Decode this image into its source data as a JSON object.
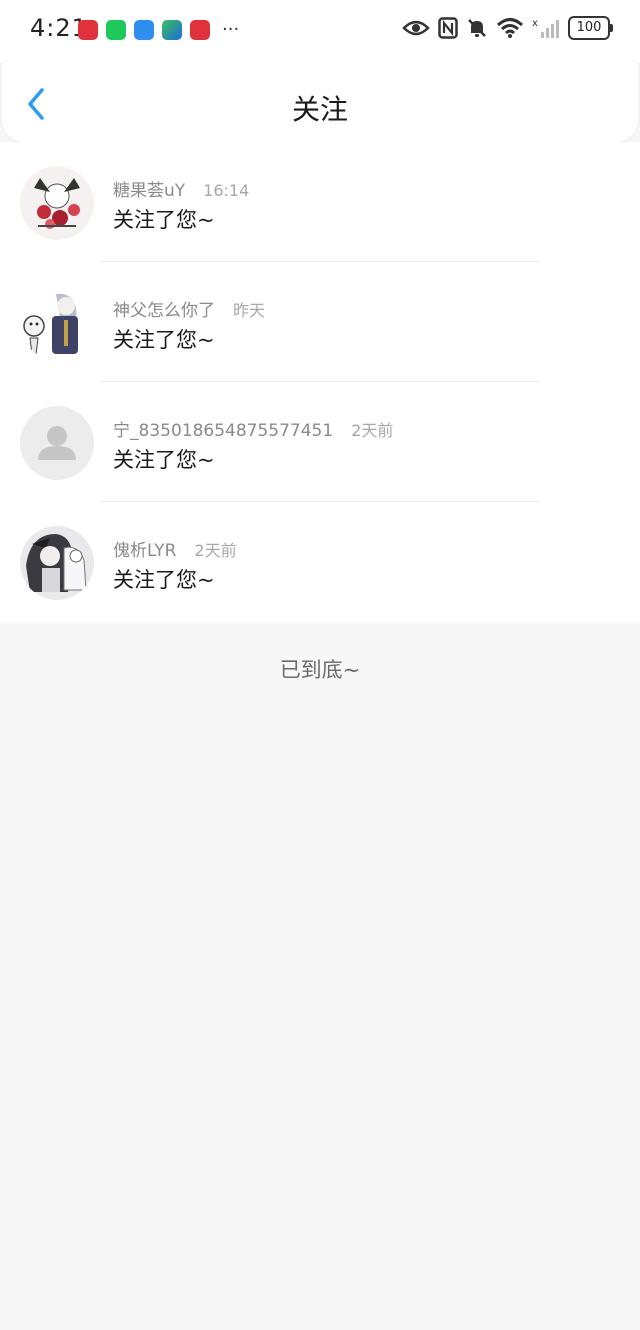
{
  "status_bar": {
    "time": "4:21",
    "battery": "100",
    "more": "···",
    "app_icons": [
      {
        "name": "huawei-icon",
        "color": "#e0323c"
      },
      {
        "name": "wechat-icon",
        "color": "#1ec85a"
      },
      {
        "name": "bookmark-app-icon",
        "color": "#2f8ef0"
      },
      {
        "name": "video-app-icon",
        "color": "#3bc05a"
      },
      {
        "name": "huawei-icon",
        "color": "#e0323c"
      }
    ]
  },
  "header": {
    "title": "关注"
  },
  "list": {
    "items": [
      {
        "name": "糖果荟uY",
        "time": "16:14",
        "message": "关注了您~",
        "avatar": "anime-avatar-red"
      },
      {
        "name": "神父怎么你了",
        "time": "昨天",
        "message": "关注了您~",
        "avatar": "anime-avatar-priest"
      },
      {
        "name": "宁_835018654875577451",
        "time": "2天前",
        "message": "关注了您~",
        "avatar": "default-avatar"
      },
      {
        "name": "傀析LYR",
        "time": "2天前",
        "message": "关注了您~",
        "avatar": "anime-avatar-dark"
      }
    ]
  },
  "footer": {
    "end_text": "已到底~"
  },
  "colors": {
    "accent": "#2d9bf0",
    "background": "#f8f7f8"
  }
}
